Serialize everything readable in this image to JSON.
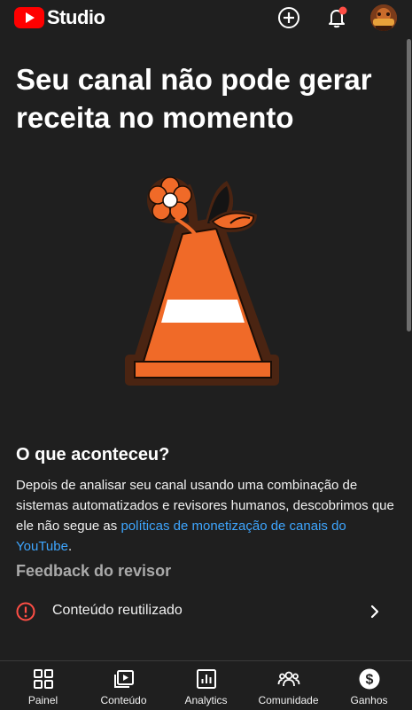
{
  "header": {
    "app_name": "Studio",
    "icons": [
      "youtube-logo-icon",
      "create-icon",
      "notifications-icon",
      "account-avatar"
    ],
    "notification_badge_color": "#ff4e45"
  },
  "main": {
    "title": "Seu canal não pode gerar receita no momento",
    "illustration": "traffic-cone-with-flower-illustration",
    "what_happened": {
      "heading": "O que aconteceu?",
      "text_before": "Depois de analisar seu canal usando uma combinação de sistemas automatizados e revisores humanos, descobrimos que ele não segue as ",
      "link_text": "políticas de monetização de canais do YouTube",
      "text_after": "."
    },
    "reviewer_feedback": {
      "heading": "Feedback do revisor",
      "items": [
        {
          "label": "Conteúdo reutilizado",
          "icon": "alert-circle-icon",
          "icon_color": "#ff4e45"
        }
      ]
    }
  },
  "bottom_nav": {
    "items": [
      {
        "label": "Painel",
        "icon": "dashboard-icon"
      },
      {
        "label": "Conteúdo",
        "icon": "content-icon"
      },
      {
        "label": "Analytics",
        "icon": "analytics-icon"
      },
      {
        "label": "Comunidade",
        "icon": "community-icon"
      },
      {
        "label": "Ganhos",
        "icon": "earn-icon"
      }
    ]
  },
  "colors": {
    "background": "#1f1f1f",
    "accent_link": "#3ea6ff",
    "brand_red": "#ff0000",
    "illustration_orange": "#f06a28",
    "illustration_brown": "#4a2412"
  }
}
